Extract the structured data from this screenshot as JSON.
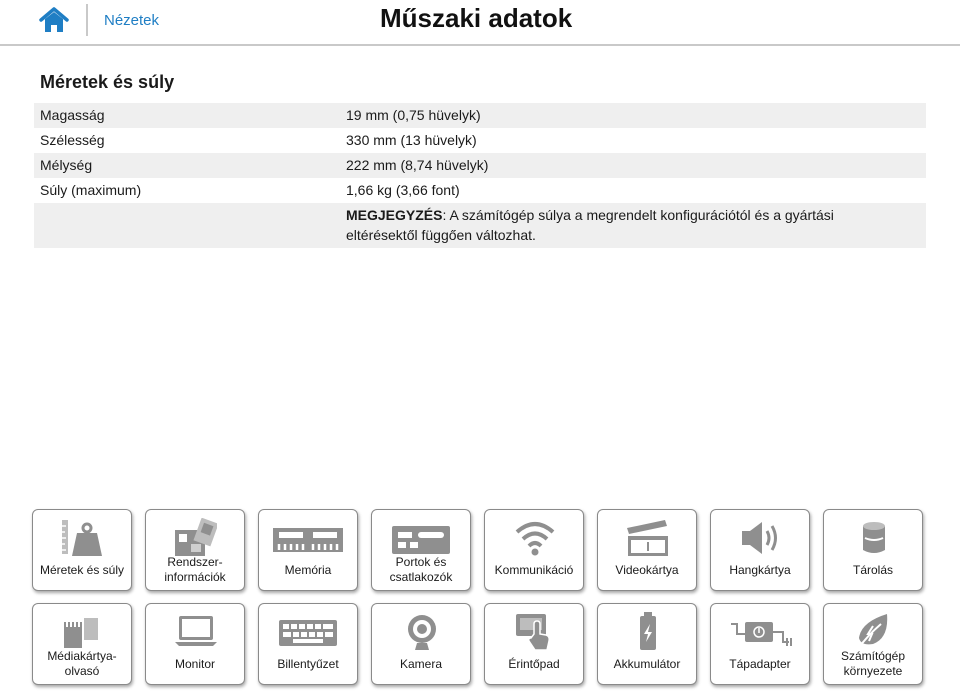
{
  "header": {
    "home_icon": "home-icon",
    "nav_link": "Nézetek",
    "title": "Műszaki adatok"
  },
  "section": {
    "title": "Méretek és súly",
    "rows": [
      {
        "label": "Magasság",
        "value": "19 mm (0,75 hüvelyk)"
      },
      {
        "label": "Szélesség",
        "value": "330 mm (13 hüvelyk)"
      },
      {
        "label": "Mélység",
        "value": "222 mm (8,74 hüvelyk)"
      },
      {
        "label": "Súly (maximum)",
        "value": "1,66 kg (3,66 font)"
      }
    ],
    "note_label": "MEGJEGYZÉS",
    "note_text": ": A számítógép súlya a megrendelt konfigurációtól és a gyártási eltérésektől függően változhat."
  },
  "tiles": [
    {
      "label": "Méretek és súly",
      "icon": "weight-ruler-icon"
    },
    {
      "label": "Rendszer-információk",
      "icon": "motherboard-icon"
    },
    {
      "label": "Memória",
      "icon": "memory-module-icon"
    },
    {
      "label": "Portok és csatlakozók",
      "icon": "ports-icon"
    },
    {
      "label": "Kommunikáció",
      "icon": "wifi-icon"
    },
    {
      "label": "Videokártya",
      "icon": "video-clapper-icon"
    },
    {
      "label": "Hangkártya",
      "icon": "speaker-icon"
    },
    {
      "label": "Tárolás",
      "icon": "storage-disk-icon"
    },
    {
      "label": "Médiakártya-olvasó",
      "icon": "media-card-icon"
    },
    {
      "label": "Monitor",
      "icon": "monitor-icon"
    },
    {
      "label": "Billentyűzet",
      "icon": "keyboard-icon"
    },
    {
      "label": "Kamera",
      "icon": "camera-icon"
    },
    {
      "label": "Érintőpad",
      "icon": "touchpad-icon"
    },
    {
      "label": "Akkumulátor",
      "icon": "battery-icon"
    },
    {
      "label": "Tápadapter",
      "icon": "power-adapter-icon"
    },
    {
      "label": "Számítógép környezete",
      "icon": "leaf-environment-icon"
    }
  ],
  "colors": {
    "accent": "#1f7ec4",
    "icon_gray": "#8f8f8f",
    "row_shade": "#efefef"
  }
}
